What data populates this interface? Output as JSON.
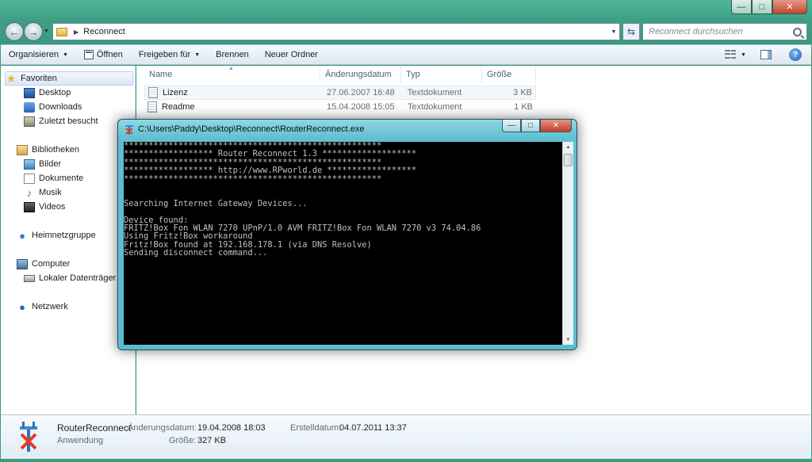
{
  "window": {
    "controls": {
      "minimize": "—",
      "maximize": "□",
      "close": "✕"
    }
  },
  "address": {
    "path": "Reconnect",
    "search_placeholder": "Reconnect durchsuchen"
  },
  "toolbar": {
    "organize": "Organisieren",
    "open": "Öffnen",
    "share": "Freigeben für",
    "burn": "Brennen",
    "new_folder": "Neuer Ordner"
  },
  "nav": {
    "favorites": "Favoriten",
    "desktop": "Desktop",
    "downloads": "Downloads",
    "recent": "Zuletzt besucht",
    "libraries": "Bibliotheken",
    "pictures": "Bilder",
    "documents": "Dokumente",
    "music": "Musik",
    "videos": "Videos",
    "homegroup": "Heimnetzgruppe",
    "computer": "Computer",
    "local_disk": "Lokaler Datenträger (C:)",
    "network": "Netzwerk"
  },
  "columns": {
    "name": "Name",
    "date": "Änderungsdatum",
    "type": "Typ",
    "size": "Größe"
  },
  "files": [
    {
      "name": "Lizenz",
      "date": "27.06.2007 16:48",
      "type": "Textdokument",
      "size": "3 KB"
    },
    {
      "name": "Readme",
      "date": "15.04.2008 15:05",
      "type": "Textdokument",
      "size": "1 KB"
    }
  ],
  "details": {
    "name": "RouterReconnect",
    "kind": "Anwendung",
    "modified_label": "Änderungsdatum:",
    "modified_value": "19.04.2008 18:03",
    "size_label": "Größe:",
    "size_value": "327 KB",
    "created_label": "Erstelldatum:",
    "created_value": "04.07.2011 13:37"
  },
  "console": {
    "title": "C:\\Users\\Paddy\\Desktop\\Reconnect\\RouterReconnect.exe",
    "lines": [
      "****************************************************",
      "****************** Router Reconnect 1.3 *******************",
      "****************************************************",
      "****************** http://www.RPworld.de ******************",
      "****************************************************",
      "",
      "",
      "Searching Internet Gateway Devices...",
      "",
      "Device found:",
      "FRITZ!Box Fon WLAN 7270 UPnP/1.0 AVM FRITZ!Box Fon WLAN 7270 v3 74.04.86",
      "Using Fritz!Box workaround",
      "Fritz!Box found at 192.168.178.1 (via DNS Resolve)",
      "Sending disconnect command..."
    ]
  }
}
